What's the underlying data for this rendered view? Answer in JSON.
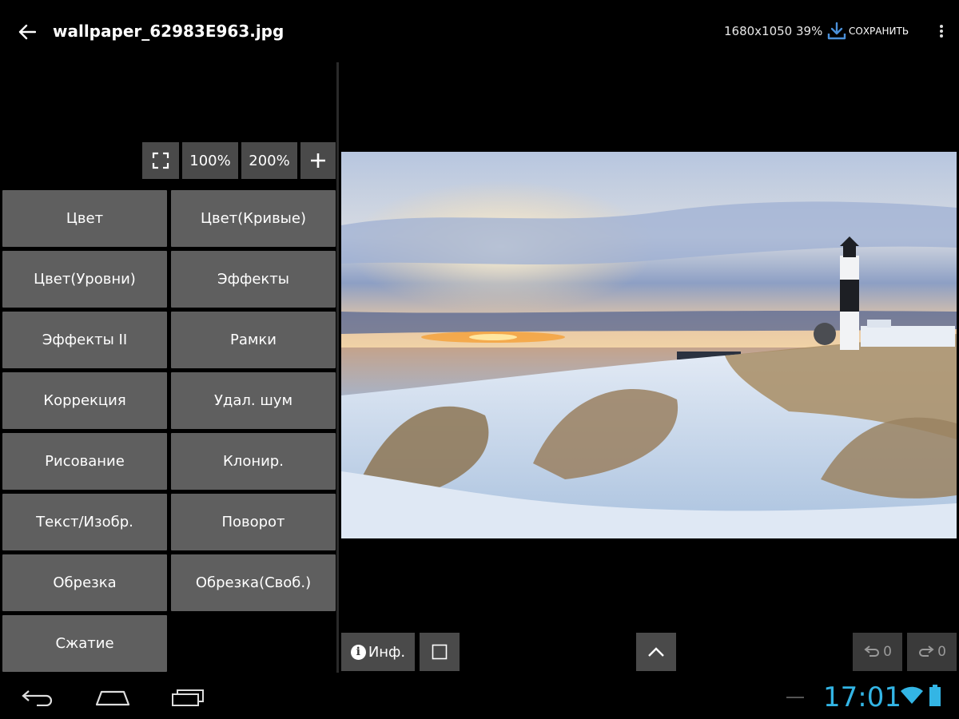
{
  "topbar": {
    "back_icon": "arrow-left-icon",
    "title": "wallpaper_62983E963.jpg",
    "image_info": "1680x1050 39%",
    "save_icon": "download-icon",
    "save_label": "СОХРАНИТЬ",
    "overflow_icon": "more-vert-icon"
  },
  "zoom": {
    "fit_icon": "fullscreen-icon",
    "zoom_100": "100%",
    "zoom_200": "200%",
    "add_icon": "plus-icon"
  },
  "tools": [
    "Цвет",
    "Цвет(Кривые)",
    "Цвет(Уровни)",
    "Эффекты",
    "Эффекты II",
    "Рамки",
    "Коррекция",
    "Удал. шум",
    "Рисование",
    "Клонир.",
    "Текст/Изобр.",
    "Поворот",
    "Обрезка",
    "Обрезка(Своб.)",
    "Сжатие"
  ],
  "bottom": {
    "info_label": "Инф.",
    "info_icon": "info-icon",
    "checkbox_icon": "square-icon",
    "up_icon": "chevron-up-icon",
    "undo_icon": "undo-icon",
    "undo_count": "0",
    "redo_icon": "redo-icon",
    "redo_count": "0"
  },
  "system_bar": {
    "back_icon": "nav-back-icon",
    "home_icon": "nav-home-icon",
    "recents_icon": "nav-recents-icon",
    "time": "17:01",
    "wifi_icon": "wifi-icon",
    "battery_icon": "battery-icon"
  },
  "colors": {
    "clock": "#33b5e5",
    "save_icon": "#4a90d9",
    "tool_button": "#5f5f5f"
  }
}
